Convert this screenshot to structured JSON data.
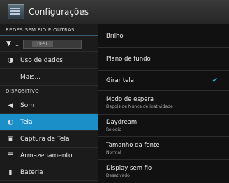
{
  "titlebar": {
    "title": "Configurações"
  },
  "sidebar": {
    "section_wireless": "REDES SEM FIO E OUTRAS",
    "wifi_toggle": "DESL",
    "items": [
      {
        "label": "Uso de dados",
        "icon": "clock-icon"
      },
      {
        "label": "Mais...",
        "icon": ""
      }
    ],
    "section_device": "DISPOSITIVO",
    "device_items": [
      {
        "label": "Som",
        "icon": "speaker-icon"
      },
      {
        "label": "Tela",
        "icon": "brightness-icon",
        "active": true
      },
      {
        "label": "Captura de Tela",
        "icon": "screenshot-icon"
      },
      {
        "label": "Armazenamento",
        "icon": "storage-icon"
      },
      {
        "label": "Bateria",
        "icon": "battery-icon"
      }
    ]
  },
  "content": {
    "rows": [
      {
        "label": "Brilho"
      },
      {
        "label": "Plano de fundo"
      },
      {
        "label": "Girar tela",
        "checked": true
      },
      {
        "label": "Modo de espera",
        "sub": "Depois de Nunca de inatividade"
      },
      {
        "label": "Daydream",
        "sub": "Relógio"
      },
      {
        "label": "Tamanho da fonte",
        "sub": "Normal"
      },
      {
        "label": "Display sem fio",
        "sub": "Desativado"
      }
    ]
  },
  "colors": {
    "accent": "#1a8fc8",
    "check": "#2aa8e0"
  }
}
